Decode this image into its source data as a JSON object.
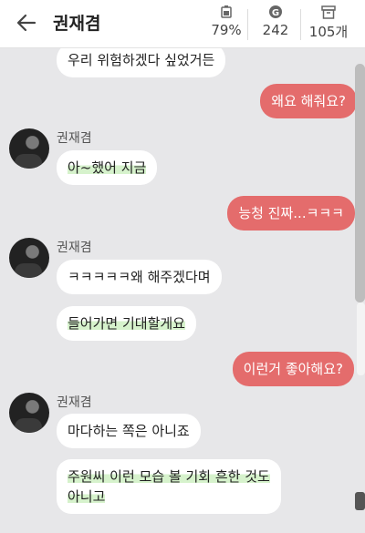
{
  "header": {
    "title": "권재겸",
    "battery": "79%",
    "coins": "242",
    "items": "105개"
  },
  "messages": [
    {
      "text": "우리 위험하겠다 싶었거든"
    },
    {
      "text": "왜요 해줘요?"
    },
    {
      "sender": "권재겸",
      "text": "아~했어 지금"
    },
    {
      "text": "능청 진짜...ㅋㅋㅋ"
    },
    {
      "sender": "권재겸",
      "text": "ㅋㅋㅋㅋㅋ왜 해주겠다며"
    },
    {
      "text": "들어가면 기대할게요"
    },
    {
      "text": "이런거 좋아해요?"
    },
    {
      "sender": "권재겸",
      "text": "마다하는 쪽은 아니죠"
    },
    {
      "text_line1": "주원씨 이런 모습 볼 기회 흔한 것도",
      "text_line2": "아니고"
    }
  ],
  "colors": {
    "outgoing_bubble": "#e46c6c",
    "incoming_bubble": "#ffffff",
    "highlight": "#d6f2cc",
    "background": "#e7e7e9"
  }
}
